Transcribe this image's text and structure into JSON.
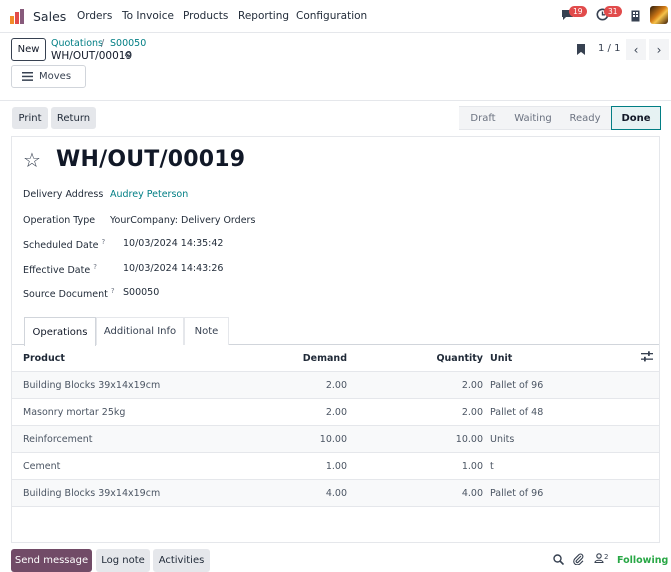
{
  "nav": {
    "app_name": "Sales",
    "menu": [
      "Orders",
      "To Invoice",
      "Products",
      "Reporting",
      "Configuration"
    ],
    "messages_count": "19",
    "activities_count": "31"
  },
  "control": {
    "new_label": "New",
    "breadcrumb": [
      "Quotations",
      "S00050"
    ],
    "breadcrumb_sep": "/",
    "record_title": "WH/OUT/00019",
    "moves_label": "Moves",
    "pager": "1 / 1"
  },
  "actions": {
    "print": "Print",
    "return": "Return"
  },
  "stages": [
    "Draft",
    "Waiting",
    "Ready",
    "Done"
  ],
  "form": {
    "title": "WH/OUT/00019",
    "fields": [
      {
        "label": "Delivery Address",
        "help": "",
        "value": "Audrey Peterson"
      },
      {
        "label": "Operation Type",
        "help": "",
        "value": "YourCompany: Delivery Orders"
      },
      {
        "label": "Scheduled Date",
        "help": "?",
        "value": "10/03/2024 14:35:42"
      },
      {
        "label": "Effective Date",
        "help": "?",
        "value": "10/03/2024 14:43:26"
      },
      {
        "label": "Source Document",
        "help": "?",
        "value": "S00050"
      }
    ]
  },
  "tabs": [
    "Operations",
    "Additional Info",
    "Note"
  ],
  "table": {
    "headers": {
      "product": "Product",
      "demand": "Demand",
      "quantity": "Quantity",
      "unit": "Unit"
    },
    "rows": [
      {
        "product": "Building Blocks 39x14x19cm",
        "demand": "2.00",
        "quantity": "2.00",
        "unit": "Pallet of 96"
      },
      {
        "product": "Masonry mortar 25kg",
        "demand": "2.00",
        "quantity": "2.00",
        "unit": "Pallet of 48"
      },
      {
        "product": "Reinforcement",
        "demand": "10.00",
        "quantity": "10.00",
        "unit": "Units"
      },
      {
        "product": "Cement",
        "demand": "1.00",
        "quantity": "1.00",
        "unit": "t"
      },
      {
        "product": "Building Blocks 39x14x19cm",
        "demand": "4.00",
        "quantity": "4.00",
        "unit": "Pallet of 96"
      }
    ]
  },
  "chatter": {
    "send_message": "Send message",
    "log_note": "Log note",
    "activities": "Activities",
    "followers_count": "2",
    "following": "Following"
  },
  "colors": {
    "brand": "#714b67",
    "link": "#017e84",
    "following": "#28a745",
    "badge": "#e14b4b"
  }
}
